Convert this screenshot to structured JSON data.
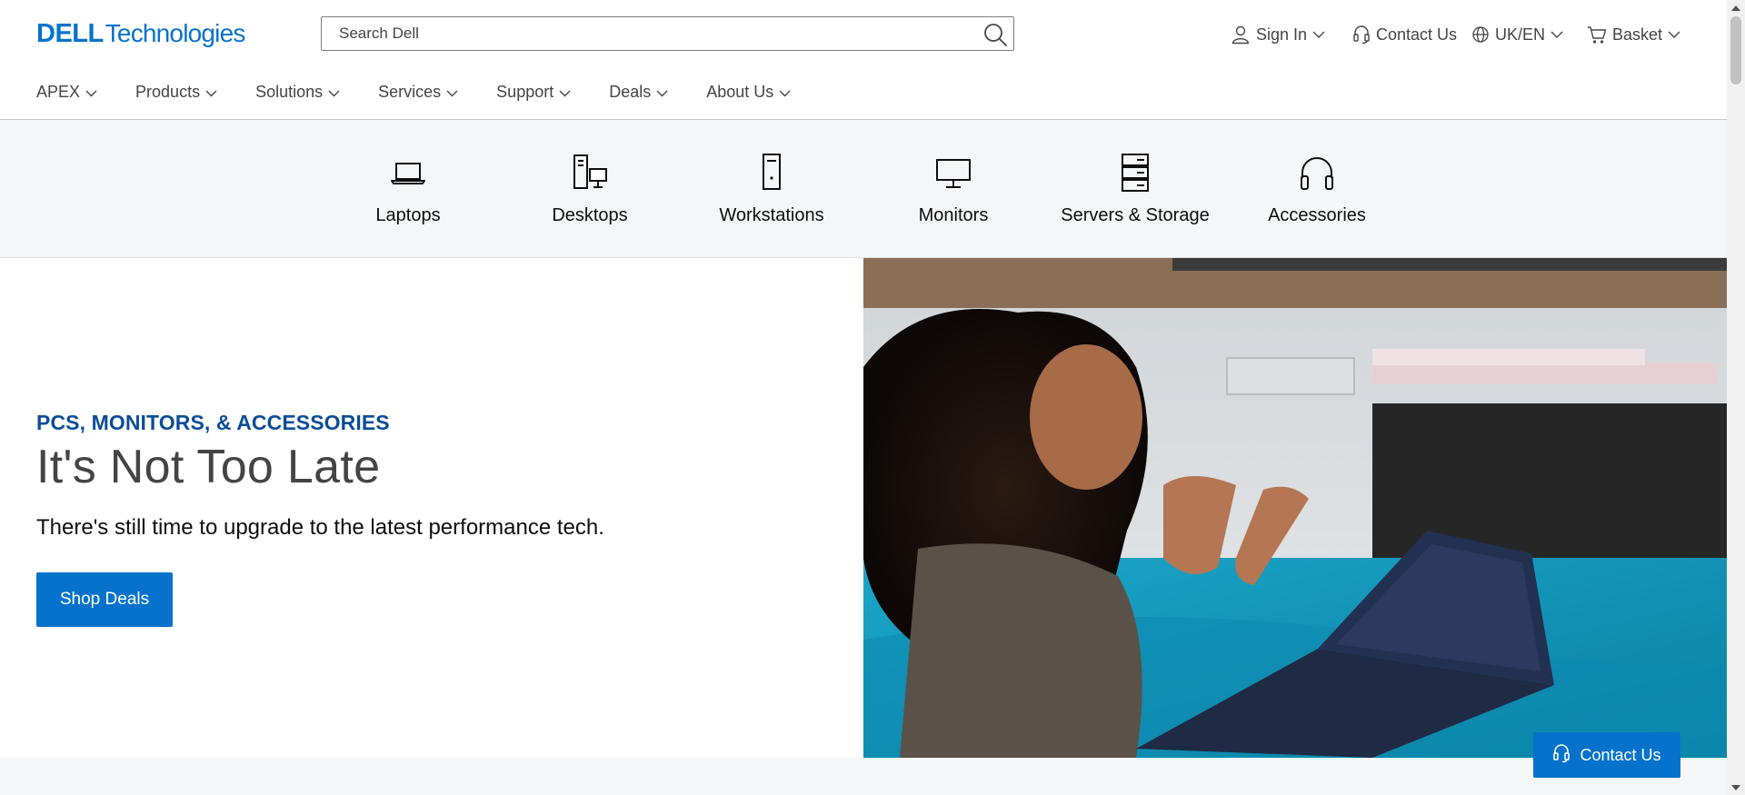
{
  "header": {
    "logo": {
      "part1": "DELL",
      "part2": "Technologies"
    },
    "search": {
      "placeholder": "Search Dell"
    },
    "utility": {
      "sign_in": "Sign In",
      "contact": "Contact Us",
      "locale": "UK/EN",
      "basket": "Basket"
    },
    "nav": [
      "APEX",
      "Products",
      "Solutions",
      "Services",
      "Support",
      "Deals",
      "About Us"
    ]
  },
  "categories": [
    "Laptops",
    "Desktops",
    "Workstations",
    "Monitors",
    "Servers & Storage",
    "Accessories"
  ],
  "hero": {
    "eyebrow": "PCS, MONITORS, & ACCESSORIES",
    "headline": "It's Not Too Late",
    "subhead": "There's still time to upgrade to the latest performance tech.",
    "cta": "Shop Deals"
  },
  "floating_contact": "Contact Us",
  "colors": {
    "brand": "#0672cb",
    "eyebrow": "#0b4d96",
    "band": "#f5f6f7"
  }
}
